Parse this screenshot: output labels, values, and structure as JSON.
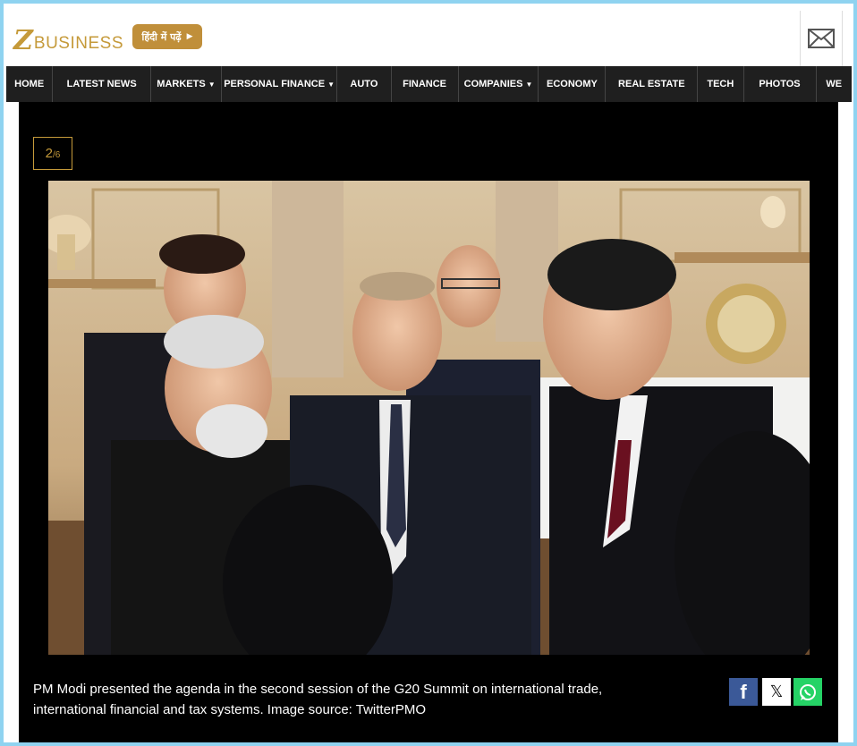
{
  "header": {
    "logo_z": "Z",
    "logo_text": "BUSINESS",
    "hindi_button": "हिंदी में पढ़ें",
    "mail_icon": "envelope-icon"
  },
  "nav": {
    "items": [
      {
        "label": "HOME",
        "dropdown": false
      },
      {
        "label": "LATEST NEWS",
        "dropdown": false
      },
      {
        "label": "MARKETS",
        "dropdown": true
      },
      {
        "label": "PERSONAL FINANCE",
        "dropdown": true
      },
      {
        "label": "AUTO",
        "dropdown": false
      },
      {
        "label": "FINANCE",
        "dropdown": false
      },
      {
        "label": "COMPANIES",
        "dropdown": true
      },
      {
        "label": "ECONOMY",
        "dropdown": false
      },
      {
        "label": "REAL ESTATE",
        "dropdown": false
      },
      {
        "label": "TECH",
        "dropdown": false
      },
      {
        "label": "PHOTOS",
        "dropdown": false
      },
      {
        "label": "WE",
        "dropdown": false
      }
    ]
  },
  "gallery": {
    "current": "2",
    "total": "/6",
    "caption": "PM Modi presented the agenda in the second session of the G20 Summit on international trade, international financial and tax systems. Image source: TwitterPMO"
  },
  "share": {
    "facebook": "f",
    "x": "𝕏",
    "whatsapp_icon": "whatsapp-icon"
  },
  "colors": {
    "brand_gold": "#c59a3a",
    "nav_bg": "#1f1f1f",
    "gallery_bg": "#000000",
    "facebook": "#3b5998",
    "whatsapp": "#25d366"
  }
}
